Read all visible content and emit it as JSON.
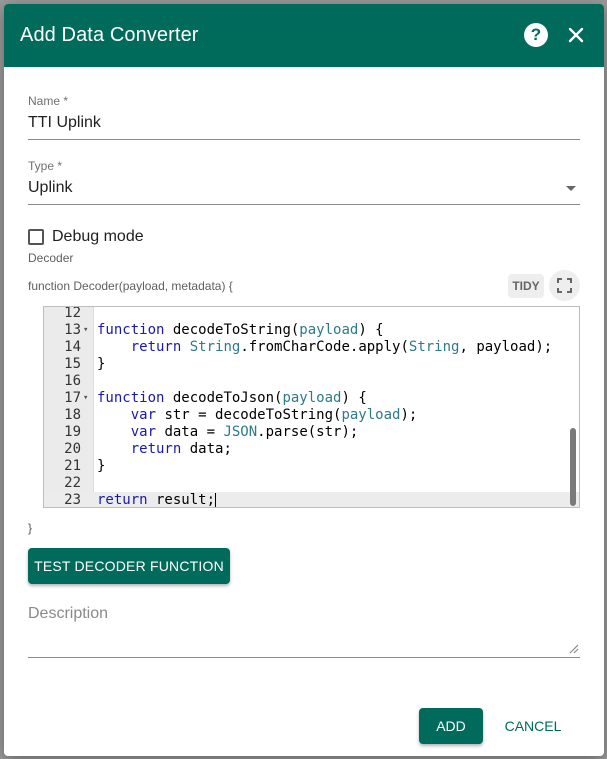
{
  "dialog": {
    "title": "Add Data Converter",
    "help_icon": "help-icon",
    "close_icon": "close-icon"
  },
  "name_field": {
    "label": "Name *",
    "value": "TTI Uplink"
  },
  "type_field": {
    "label": "Type *",
    "value": "Uplink"
  },
  "debug": {
    "label": "Debug mode",
    "checked": false
  },
  "decoder": {
    "section_label": "Decoder",
    "signature": "function Decoder(payload, metadata) {",
    "closing": "}",
    "tidy_label": "TIDY",
    "fullscreen_icon": "fullscreen-icon",
    "lines": [
      {
        "n": "12",
        "fold": "",
        "code": ""
      },
      {
        "n": "13",
        "fold": "▾",
        "code": "function decodeToString(payload) {"
      },
      {
        "n": "14",
        "fold": "",
        "code": "    return String.fromCharCode.apply(String, payload);"
      },
      {
        "n": "15",
        "fold": "",
        "code": "}"
      },
      {
        "n": "16",
        "fold": "",
        "code": ""
      },
      {
        "n": "17",
        "fold": "▾",
        "code": "function decodeToJson(payload) {"
      },
      {
        "n": "18",
        "fold": "",
        "code": "    var str = decodeToString(payload);"
      },
      {
        "n": "19",
        "fold": "",
        "code": "    var data = JSON.parse(str);"
      },
      {
        "n": "20",
        "fold": "",
        "code": "    return data;"
      },
      {
        "n": "21",
        "fold": "",
        "code": "}"
      },
      {
        "n": "22",
        "fold": "",
        "code": ""
      },
      {
        "n": "23",
        "fold": "",
        "code": "return result;"
      }
    ]
  },
  "test_button": {
    "label": "TEST DECODER FUNCTION"
  },
  "description": {
    "placeholder": "Description"
  },
  "actions": {
    "add_label": "ADD",
    "cancel_label": "CANCEL"
  },
  "colors": {
    "accent": "#006b5b"
  }
}
